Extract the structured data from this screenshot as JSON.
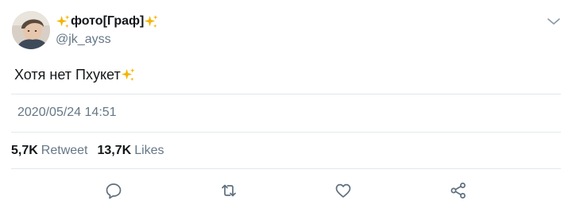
{
  "tweet": {
    "display_name": "фото[Граф]",
    "username": "@jk_ayss",
    "text": "Хотя нет Пхукет",
    "timestamp": "2020/05/24 14:51",
    "retweet_count": "5,7K",
    "retweet_label": "Retweet",
    "like_count": "13,7K",
    "like_label": "Likes"
  },
  "icons": {
    "sparkle": "sparkles-emoji",
    "menu": "chevron-down-icon",
    "reply": "reply-bubble-icon",
    "retweet": "retweet-icon",
    "like": "heart-icon",
    "share": "share-icon"
  },
  "colors": {
    "text_primary": "#14171a",
    "text_secondary": "#657786",
    "divider": "#e1e8ed",
    "icon_gray": "#657786",
    "sparkle_gold": "#f4b400"
  }
}
